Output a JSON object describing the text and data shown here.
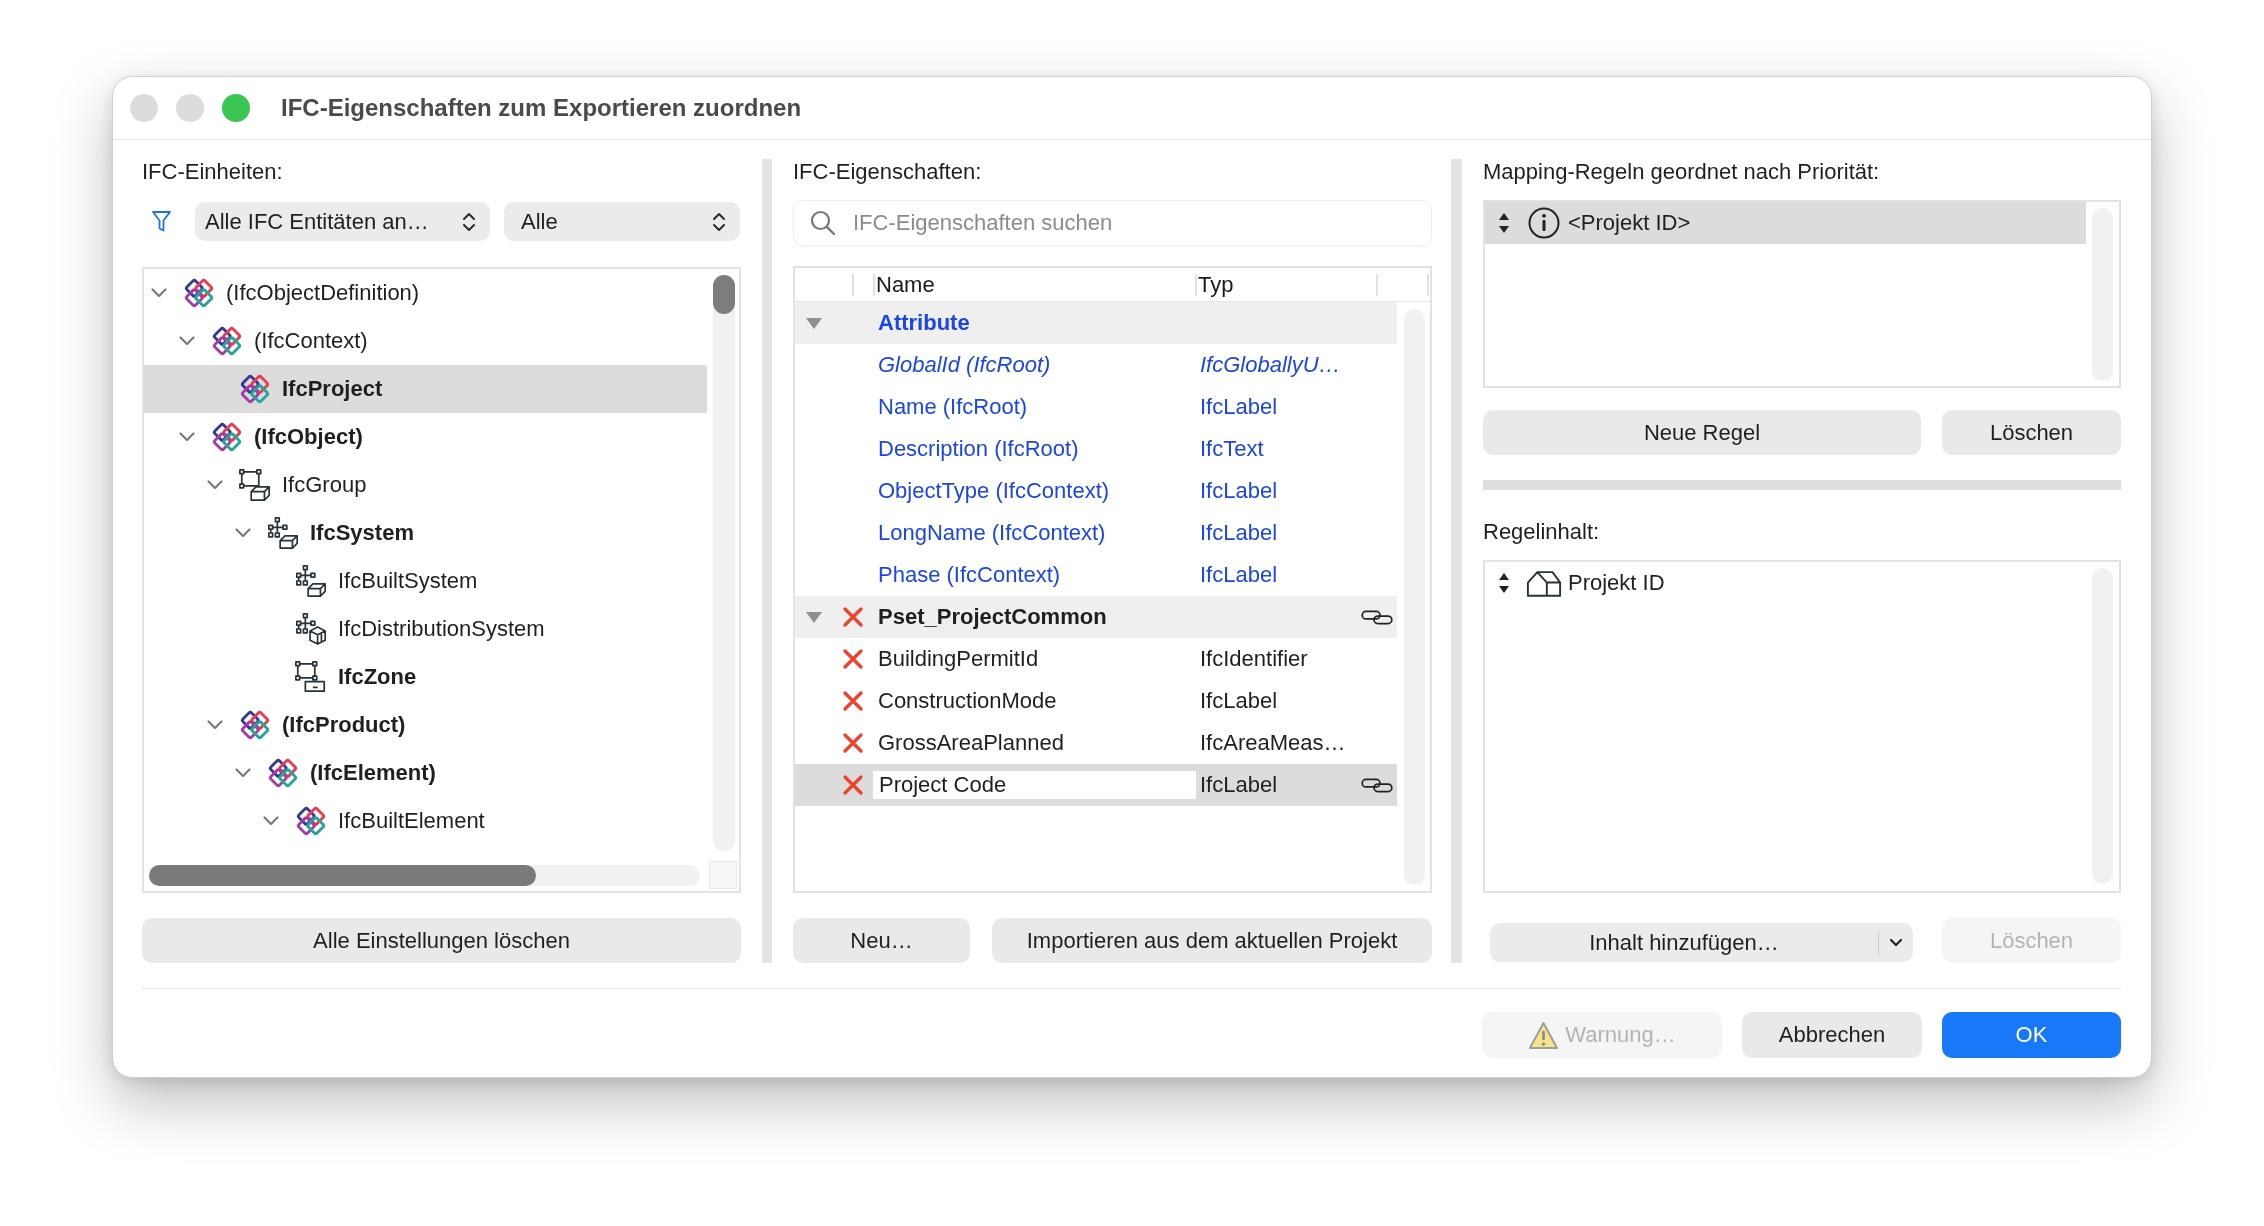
{
  "window": {
    "title": "IFC-Eigenschaften zum Exportieren zuordnen",
    "controls": [
      {
        "color": "#dcdcdc"
      },
      {
        "color": "#dcdcdc"
      },
      {
        "color": "#3bc553"
      }
    ]
  },
  "entities_panel": {
    "label": "IFC-Einheiten:",
    "filters": [
      {
        "value": "Alle IFC Entitäten an…"
      },
      {
        "value": "Alle"
      }
    ],
    "tree": [
      {
        "label": "(IfcObjectDefinition)",
        "kind": "entity",
        "bold": false,
        "selected": false,
        "expanded": true,
        "children": [
          {
            "label": "(IfcContext)",
            "kind": "entity",
            "bold": false,
            "selected": false,
            "expanded": true,
            "children": [
              {
                "label": "IfcProject",
                "kind": "entity",
                "bold": true,
                "selected": true
              }
            ]
          },
          {
            "label": "(IfcObject)",
            "kind": "entity",
            "bold": true,
            "selected": false,
            "expanded": true,
            "children": [
              {
                "label": "IfcGroup",
                "kind": "group",
                "bold": false,
                "selected": false,
                "expanded": true,
                "children": [
                  {
                    "label": "IfcSystem",
                    "kind": "system",
                    "bold": true,
                    "selected": false,
                    "expanded": true,
                    "children": [
                      {
                        "label": "IfcBuiltSystem",
                        "kind": "builtsystem",
                        "bold": false,
                        "selected": false
                      },
                      {
                        "label": "IfcDistributionSystem",
                        "kind": "distribution",
                        "bold": false,
                        "selected": false
                      },
                      {
                        "label": "IfcZone",
                        "kind": "zone",
                        "bold": true,
                        "selected": false
                      }
                    ]
                  }
                ]
              },
              {
                "label": "(IfcProduct)",
                "kind": "entity",
                "bold": true,
                "selected": false,
                "expanded": true,
                "children": [
                  {
                    "label": "(IfcElement)",
                    "kind": "entity",
                    "bold": true,
                    "selected": false,
                    "expanded": true,
                    "children": [
                      {
                        "label": "IfcBuiltElement",
                        "kind": "entity",
                        "bold": false,
                        "selected": false,
                        "expanded": true
                      }
                    ]
                  }
                ]
              }
            ]
          }
        ]
      }
    ],
    "clear_button": "Alle Einstellungen löschen"
  },
  "properties_panel": {
    "label": "IFC-Eigenschaften:",
    "search": {
      "placeholder": "IFC-Eigenschaften suchen"
    },
    "table": {
      "columns": [
        "Name",
        "Typ"
      ],
      "groups": [
        {
          "name": "Attribute",
          "kind": "attribute",
          "expanded": true,
          "selected": false,
          "cross_mark": false,
          "linked": false,
          "rows": [
            {
              "name": "GlobalId (IfcRoot)",
              "type": "IfcGloballyU…",
              "italic": true,
              "cross_mark": false,
              "linked": false,
              "selected": false,
              "editing": false
            },
            {
              "name": "Name (IfcRoot)",
              "type": "IfcLabel",
              "italic": false,
              "cross_mark": false,
              "linked": false,
              "selected": false,
              "editing": false
            },
            {
              "name": "Description (IfcRoot)",
              "type": "IfcText",
              "italic": false,
              "cross_mark": false,
              "linked": false,
              "selected": false,
              "editing": false
            },
            {
              "name": "ObjectType (IfcContext)",
              "type": "IfcLabel",
              "italic": false,
              "cross_mark": false,
              "linked": false,
              "selected": false,
              "editing": false
            },
            {
              "name": "LongName (IfcContext)",
              "type": "IfcLabel",
              "italic": false,
              "cross_mark": false,
              "linked": false,
              "selected": false,
              "editing": false
            },
            {
              "name": "Phase (IfcContext)",
              "type": "IfcLabel",
              "italic": false,
              "cross_mark": false,
              "linked": false,
              "selected": false,
              "editing": false
            }
          ]
        },
        {
          "name": "Pset_ProjectCommon",
          "kind": "pset",
          "expanded": true,
          "selected": false,
          "cross_mark": true,
          "linked": true,
          "rows": [
            {
              "name": "BuildingPermitId",
              "type": "IfcIdentifier",
              "italic": false,
              "cross_mark": true,
              "linked": false,
              "selected": false,
              "editing": false
            },
            {
              "name": "ConstructionMode",
              "type": "IfcLabel",
              "italic": false,
              "cross_mark": true,
              "linked": false,
              "selected": false,
              "editing": false
            },
            {
              "name": "GrossAreaPlanned",
              "type": "IfcAreaMeas…",
              "italic": false,
              "cross_mark": true,
              "linked": false,
              "selected": false,
              "editing": false
            },
            {
              "name": "Project Code",
              "type": "IfcLabel",
              "italic": false,
              "cross_mark": true,
              "linked": true,
              "selected": true,
              "editing": true
            }
          ]
        }
      ]
    },
    "buttons": [
      "Neu…",
      "Importieren aus dem aktuellen Projekt"
    ]
  },
  "mapping_panel": {
    "label": "Mapping-Regeln geordnet nach Priorität:",
    "rules": [
      {
        "label": "<Projekt ID>",
        "selected": true
      }
    ],
    "rule_buttons": [
      {
        "label": "Neue Regel",
        "disabled": false
      },
      {
        "label": "Löschen",
        "disabled": false
      }
    ],
    "content_label": "Regelinhalt:",
    "content_items": [
      {
        "label": "Projekt ID",
        "selected": false
      }
    ],
    "add_content": {
      "label": "Inhalt hinzufügen…"
    },
    "content_delete": {
      "label": "Löschen",
      "disabled": true
    }
  },
  "footer": {
    "buttons": [
      {
        "label": "Warnung…",
        "kind": "warning",
        "disabled": true
      },
      {
        "label": "Abbrechen",
        "kind": "cancel",
        "disabled": false
      },
      {
        "label": "OK",
        "kind": "default",
        "disabled": false
      }
    ]
  }
}
